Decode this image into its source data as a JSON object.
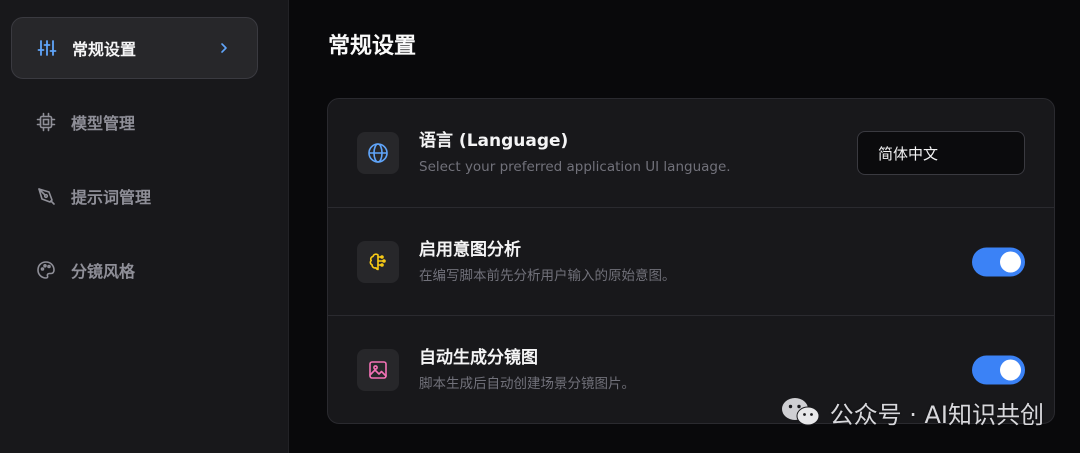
{
  "sidebar": {
    "items": [
      {
        "label": "常规设置",
        "icon": "sliders-icon",
        "active": true
      },
      {
        "label": "模型管理",
        "icon": "cpu-chip-icon",
        "active": false
      },
      {
        "label": "提示词管理",
        "icon": "pen-nib-icon",
        "active": false
      },
      {
        "label": "分镜风格",
        "icon": "palette-icon",
        "active": false
      }
    ]
  },
  "main": {
    "title": "常规设置",
    "settings": [
      {
        "title": "语言 (Language)",
        "description": "Select your preferred application UI language.",
        "icon": "globe-icon",
        "control": "select",
        "value": "简体中文"
      },
      {
        "title": "启用意图分析",
        "description": "在编写脚本前先分析用户输入的原始意图。",
        "icon": "brain-icon",
        "control": "toggle",
        "enabled": true
      },
      {
        "title": "自动生成分镜图",
        "description": "脚本生成后自动创建场景分镜图片。",
        "icon": "image-icon",
        "control": "toggle",
        "enabled": true
      }
    ]
  },
  "watermark": {
    "text": "公众号 · AI知识共创",
    "icon": "wechat-icon"
  },
  "colors": {
    "accent": "#3b82f6",
    "globe_icon": "#60a5fa",
    "brain_icon": "#facc15",
    "image_icon": "#f472b6"
  }
}
